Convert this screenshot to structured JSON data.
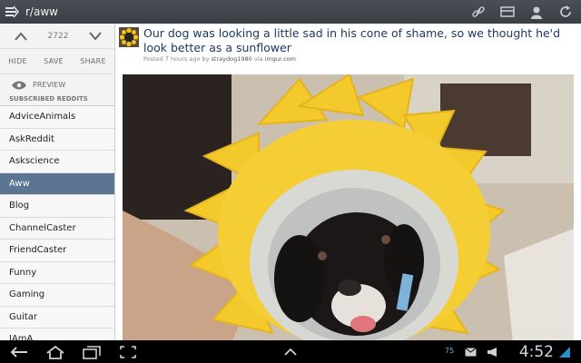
{
  "titlebar": {
    "title": "r/aww",
    "actions": [
      "link-icon",
      "inbox-icon",
      "user-icon",
      "refresh-icon"
    ]
  },
  "sidebar": {
    "score": "2722",
    "actions": [
      "HIDE",
      "SAVE",
      "SHARE"
    ],
    "preview_label": "PREVIEW",
    "section_title": "SUBSCRIBED REDDITS",
    "selected": "Aww",
    "items": [
      "AdviceAnimals",
      "AskReddit",
      "Askscience",
      "Aww",
      "Blog",
      "ChannelCaster",
      "FriendCaster",
      "Funny",
      "Gaming",
      "Guitar",
      "IAmA"
    ]
  },
  "post": {
    "title": "Our dog was looking a little sad in his cone of shame, so we thought he'd look better as a sunflower",
    "meta_prefix": "Posted 7 hours ago by",
    "author": "straydog1980",
    "meta_via": "via",
    "domain": "imgur.com"
  },
  "system_bar": {
    "time": "4:52",
    "notification_count": "75"
  },
  "colors": {
    "titlebar": "#3f434a",
    "selected_item": "#5b7592",
    "post_title": "#1c3a62"
  }
}
